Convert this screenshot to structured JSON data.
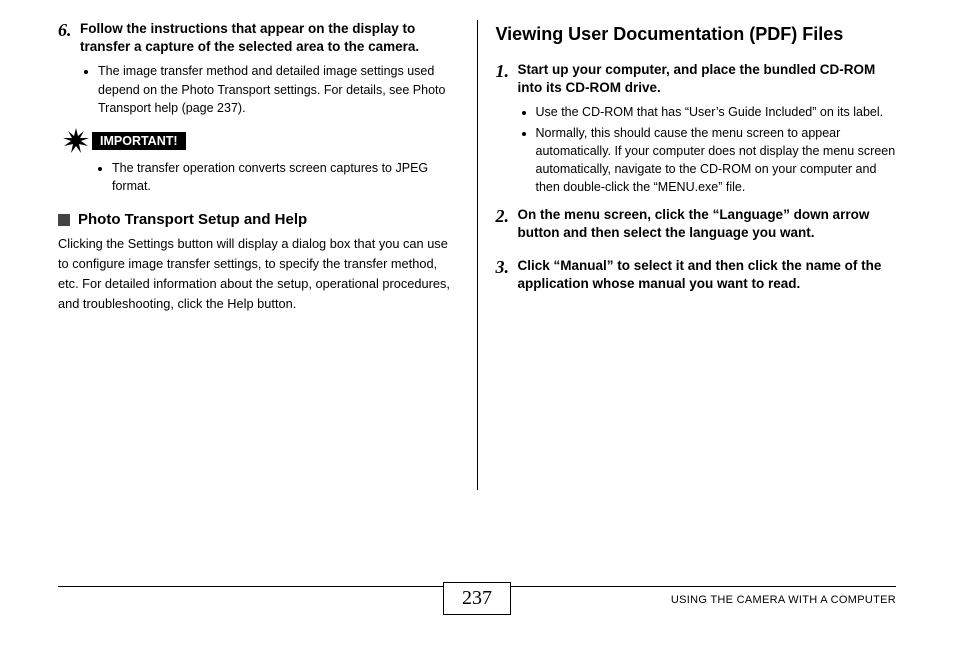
{
  "left": {
    "step6_num": "6.",
    "step6_text": "Follow the instructions that appear on the display to transfer a capture of the selected area to the camera.",
    "step6_bullet": "The image transfer method and detailed image settings used depend on the Photo Transport settings. For details, see Photo Transport help (page 237).",
    "important_label": "IMPORTANT!",
    "important_bullet": "The transfer operation converts screen captures to JPEG format.",
    "subhead": "Photo Transport Setup and Help",
    "body": "Clicking the Settings button will display a dialog box that you can use to configure image transfer settings, to specify the transfer method, etc. For detailed information about the setup, operational procedures, and troubleshooting, click the Help button."
  },
  "right": {
    "heading": "Viewing User Documentation (PDF) Files",
    "step1_num": "1.",
    "step1_text": "Start up your computer, and place the bundled CD-ROM into its CD-ROM drive.",
    "step1_bullet_a": "Use the CD-ROM that has “User’s Guide Included” on its label.",
    "step1_bullet_b": "Normally, this should cause the menu screen to appear automatically. If your computer does not display the menu screen automatically, navigate to the CD-ROM on your computer and then double-click the “MENU.exe” file.",
    "step2_num": "2.",
    "step2_text": "On the menu screen, click the “Language” down arrow button and then select the language you want.",
    "step3_num": "3.",
    "step3_text": "Click “Manual” to select it and then click the name of the application whose manual you want to read."
  },
  "footer": {
    "page_number": "237",
    "chapter": "USING THE CAMERA WITH A COMPUTER"
  }
}
